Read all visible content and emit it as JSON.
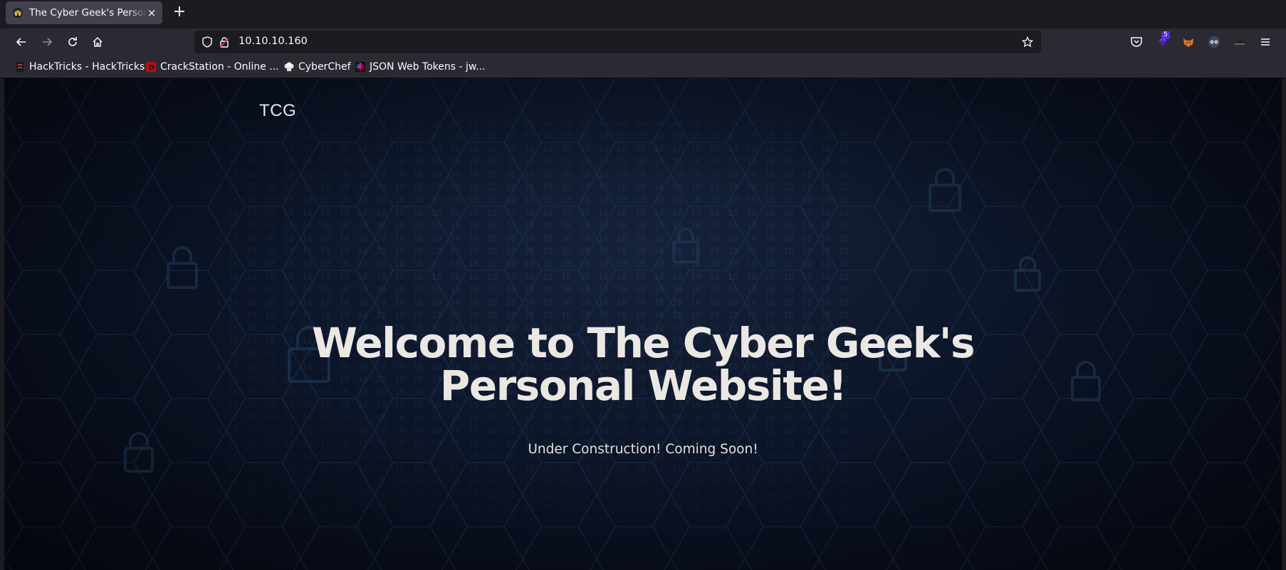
{
  "browser": {
    "tab": {
      "title": "The Cyber Geek's Personal Website",
      "close_glyph": "×"
    },
    "new_tab_glyph": "+",
    "url": "10.10.10.160",
    "extension_badge": "5",
    "icons": [
      "back-icon",
      "forward-icon",
      "reload-icon",
      "home-icon",
      "shield-icon",
      "lock-icon",
      "star-icon",
      "pocket-icon",
      "extension-icon",
      "fox-icon",
      "glasses-icon",
      "hat-icon",
      "menu-icon"
    ]
  },
  "bookmarks": [
    {
      "label": "HackTricks - HackTricks",
      "icon": "hacktricks-icon"
    },
    {
      "label": "CrackStation - Online ...",
      "icon": "crackstation-icon"
    },
    {
      "label": "CyberChef",
      "icon": "chef-hat-icon"
    },
    {
      "label": "JSON Web Tokens - jw...",
      "icon": "jwt-icon"
    }
  ],
  "site": {
    "logo": "TCG",
    "headline_line1": "Welcome to The Cyber Geek's",
    "headline_line2": "Personal Website!",
    "subtitle": "Under Construction! Coming Soon!"
  },
  "colors": {
    "chrome_dark": "#1c1b22",
    "chrome": "#2b2a33",
    "tab_active": "#42414d",
    "page_bg": "#0c1528",
    "text": "#ebe8e4"
  }
}
